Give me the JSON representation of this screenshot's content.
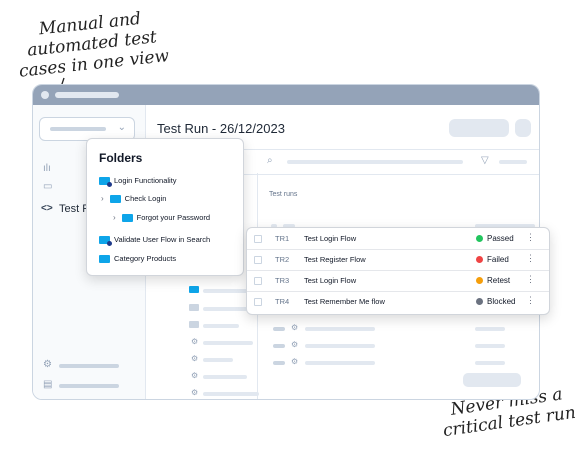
{
  "annotations": {
    "top": "Manual and automated test cases in one view",
    "bottom": "Never miss a critical test run"
  },
  "sidebar": {
    "active_item": {
      "icon": "code-icon",
      "label": "Test Ru"
    }
  },
  "main": {
    "title": "Test Run - 26/12/2023",
    "column_header": "Test runs"
  },
  "folders": {
    "title": "Folders",
    "items": [
      {
        "label": "Login Functionality",
        "icon": "folder-gear-icon"
      },
      {
        "label": "Check Login",
        "icon": "folder-icon"
      },
      {
        "label": "Forgot your Password",
        "icon": "folder-icon"
      },
      {
        "label": "Validate User Flow in Search",
        "icon": "folder-gear-icon"
      },
      {
        "label": "Category Products",
        "icon": "folder-icon"
      }
    ]
  },
  "test_runs": [
    {
      "id": "TR1",
      "name": "Test Login Flow",
      "status": "Passed",
      "status_color": "#22c55e"
    },
    {
      "id": "TR2",
      "name": "Test Register Flow",
      "status": "Failed",
      "status_color": "#ef4444"
    },
    {
      "id": "TR3",
      "name": "Test Login Flow",
      "status": "Retest",
      "status_color": "#f59e0b"
    },
    {
      "id": "TR4",
      "name": "Test Remember Me flow",
      "status": "Blocked",
      "status_color": "#6b7280"
    }
  ],
  "colors": {
    "accent": "#0ea5e9",
    "titlebar": "#94a3b8"
  }
}
